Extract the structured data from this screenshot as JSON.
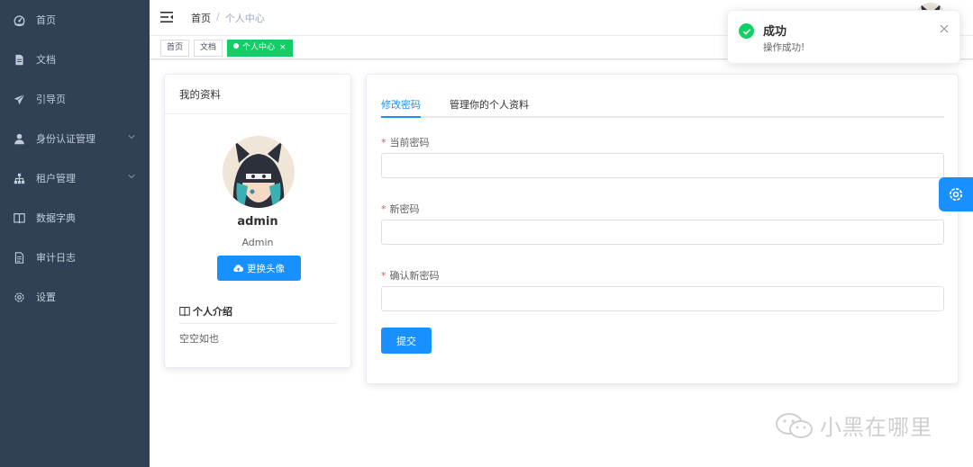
{
  "sidebar": {
    "items": [
      {
        "label": "首页",
        "icon": "dashboard-icon"
      },
      {
        "label": "文档",
        "icon": "document-icon"
      },
      {
        "label": "引导页",
        "icon": "guide-icon"
      },
      {
        "label": "身份认证管理",
        "icon": "user-icon",
        "expandable": true
      },
      {
        "label": "租户管理",
        "icon": "tree-icon",
        "expandable": true
      },
      {
        "label": "数据字典",
        "icon": "book-icon"
      },
      {
        "label": "审计日志",
        "icon": "log-icon"
      },
      {
        "label": "设置",
        "icon": "gear-icon"
      }
    ]
  },
  "navbar": {
    "breadcrumb": {
      "home": "首页",
      "separator": "/",
      "current": "个人中心"
    }
  },
  "tags": [
    {
      "label": "首页",
      "active": false
    },
    {
      "label": "文档",
      "active": false
    },
    {
      "label": "个人中心",
      "active": true,
      "close": "×"
    }
  ],
  "profile": {
    "title": "我的资料",
    "username": "admin",
    "role": "Admin",
    "upload_button": "更换头像",
    "intro_title": "个人介绍",
    "intro_text": "空空如也"
  },
  "password_form": {
    "tabs": [
      {
        "label": "修改密码",
        "active": true
      },
      {
        "label": "管理你的个人资料",
        "active": false
      }
    ],
    "fields": {
      "current": {
        "label": "当前密码",
        "required_mark": "*",
        "value": ""
      },
      "new": {
        "label": "新密码",
        "required_mark": "*",
        "value": ""
      },
      "confirm": {
        "label": "确认新密码",
        "required_mark": "*",
        "value": ""
      }
    },
    "submit": "提交"
  },
  "notification": {
    "title": "成功",
    "message": "操作成功!",
    "type": "success"
  },
  "watermark": "小黑在哪里",
  "colors": {
    "sidebar_bg": "#304156",
    "primary": "#1890ff",
    "success": "#13ce66",
    "required": "#ff4949"
  }
}
